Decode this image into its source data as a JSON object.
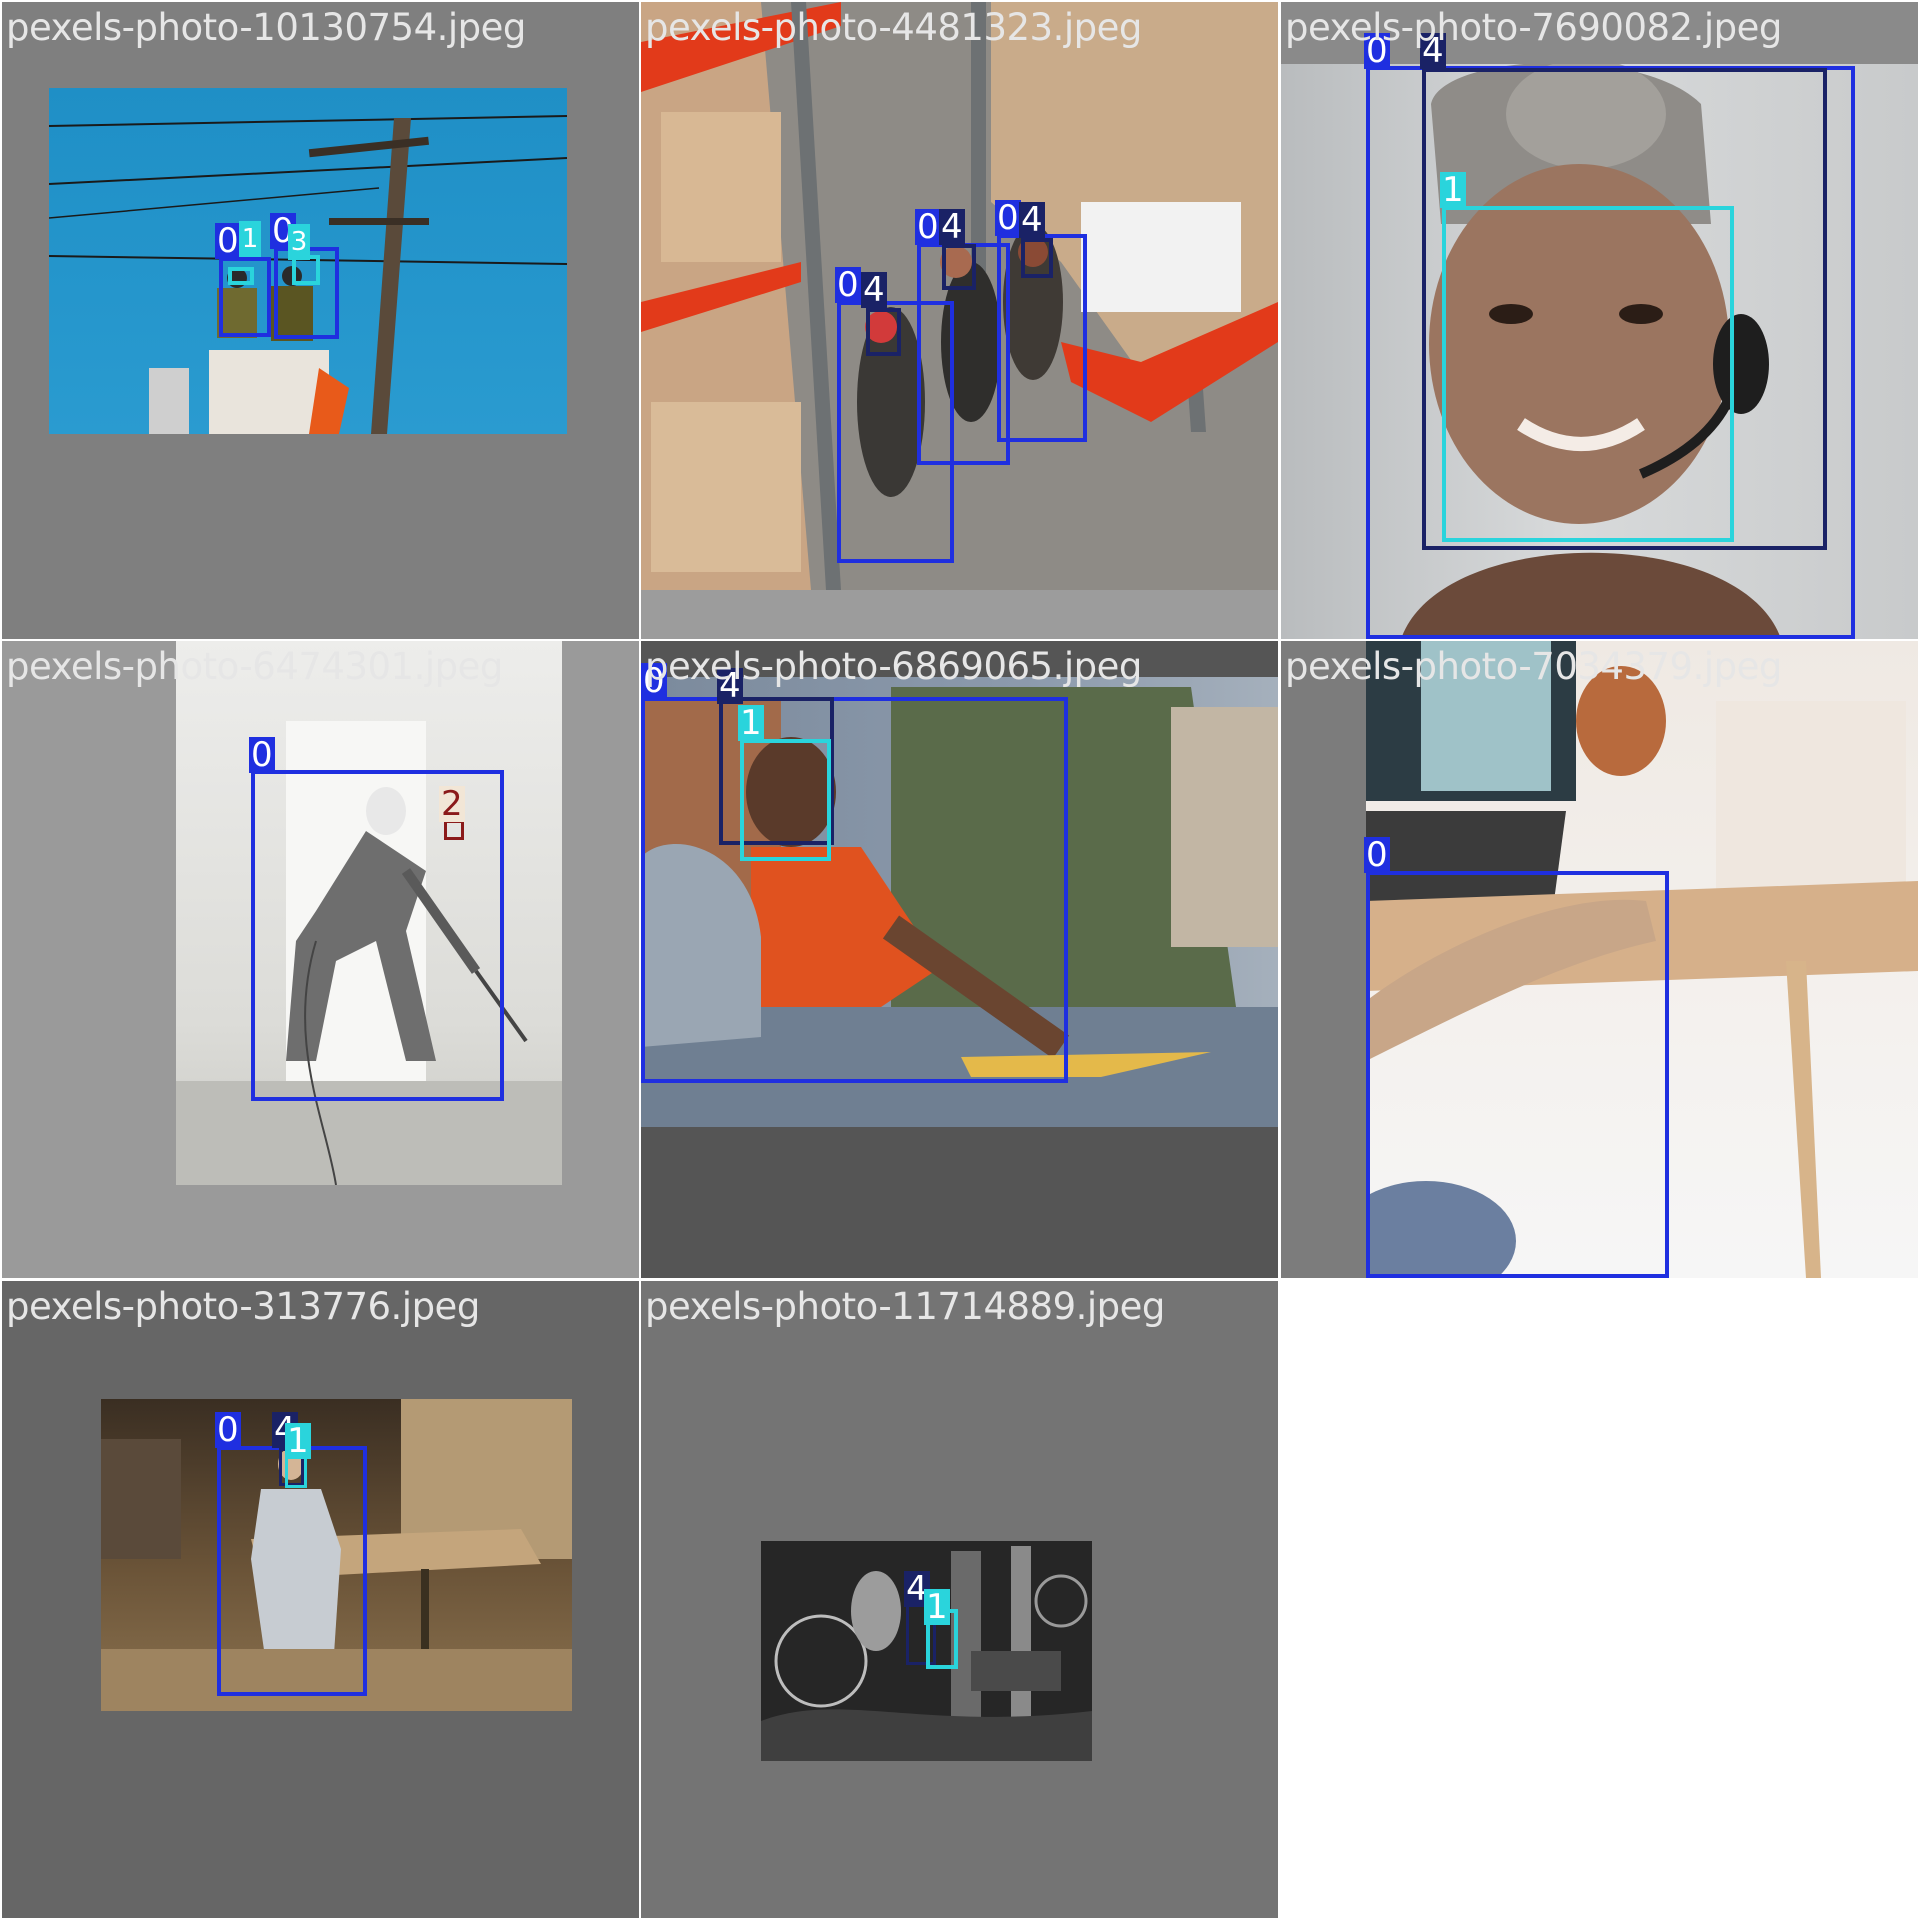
{
  "grid": {
    "tiles": [
      {
        "filename": "pexels-photo-10130754.jpeg",
        "labels": [
          "0",
          "1",
          "0",
          "3"
        ]
      },
      {
        "filename": "pexels-photo-4481323.jpeg",
        "labels": [
          "0",
          "4",
          "0",
          "4",
          "0",
          "4"
        ]
      },
      {
        "filename": "pexels-photo-7690082.jpeg",
        "labels": [
          "0",
          "4",
          "1"
        ]
      },
      {
        "filename": "pexels-photo-6474301.jpeg",
        "labels": [
          "0",
          "2"
        ]
      },
      {
        "filename": "pexels-photo-6869065.jpeg",
        "labels": [
          "0",
          "4",
          "1"
        ]
      },
      {
        "filename": "pexels-photo-7034379.jpeg",
        "labels": [
          "0"
        ]
      },
      {
        "filename": "pexels-photo-313776.jpeg",
        "labels": [
          "0",
          "4",
          "1"
        ]
      },
      {
        "filename": "pexels-photo-11714889.jpeg",
        "labels": [
          "4",
          "1"
        ]
      }
    ]
  },
  "colors": {
    "class_0": "#1f2fe0",
    "class_1": "#2ad4dc",
    "class_2": "#8b1a1a",
    "class_4": "#1a2266"
  }
}
